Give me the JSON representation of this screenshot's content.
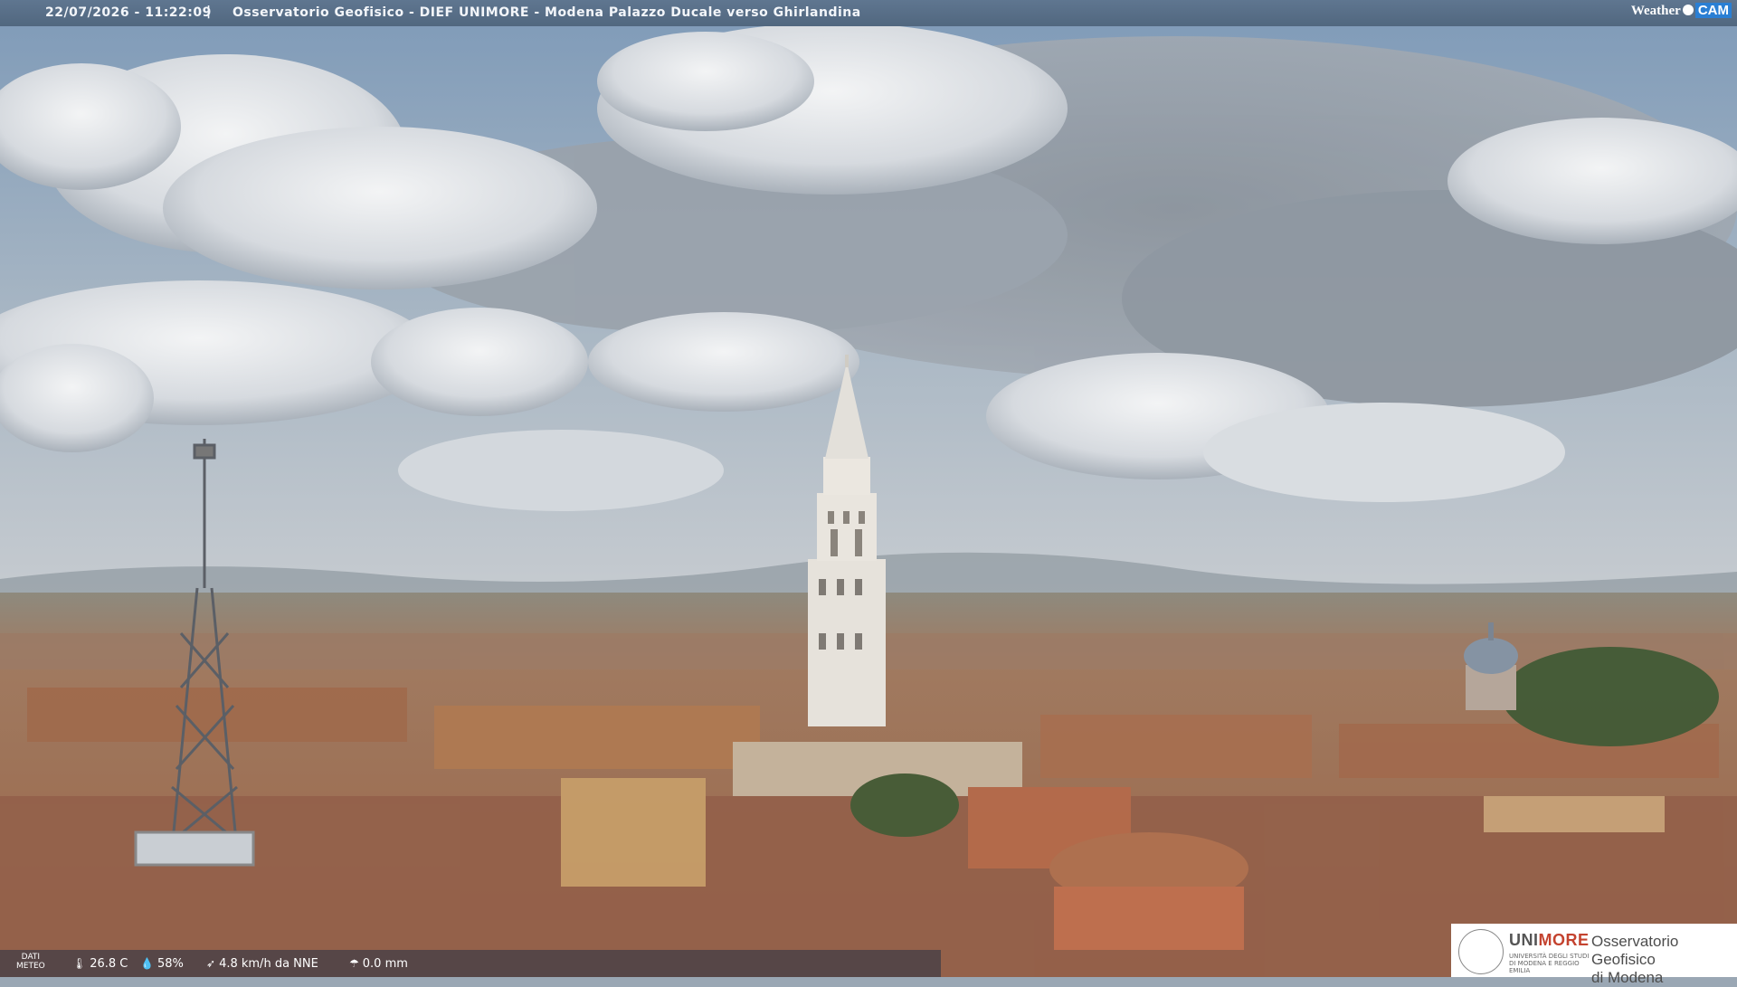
{
  "header": {
    "timestamp": "22/07/2026 - 11:22:09",
    "separator": "|",
    "title": "Osservatorio Geofisico - DIEF UNIMORE - Modena Palazzo Ducale verso Ghirlandina",
    "brand_weather": "Weather",
    "brand_cam": "CAM"
  },
  "meteo": {
    "label_line1": "DATI",
    "label_line2": "METEO",
    "temperature": "26.8 C",
    "humidity": "58%",
    "wind": "4.8 km/h da NNE",
    "rain": "0.0 mm",
    "icons": [
      "thermometer-icon",
      "humidity-icon",
      "wind-icon",
      "rain-icon"
    ]
  },
  "logo": {
    "uni_part1": "UNI",
    "uni_part2": "MORE",
    "sub": "UNIVERSITÀ DEGLI STUDI DI MODENA E REGGIO EMILIA",
    "observatory_line1": "Osservatorio Geofisico",
    "observatory_line2": "di Modena"
  },
  "colors": {
    "sky_top": "#7e9ab8",
    "cloud": "#e9ecef",
    "cloud_shadow": "#8f98a2",
    "roof": "#a86e4f",
    "tower": "#e7e3dc",
    "brand_accent": "#c4432f"
  }
}
